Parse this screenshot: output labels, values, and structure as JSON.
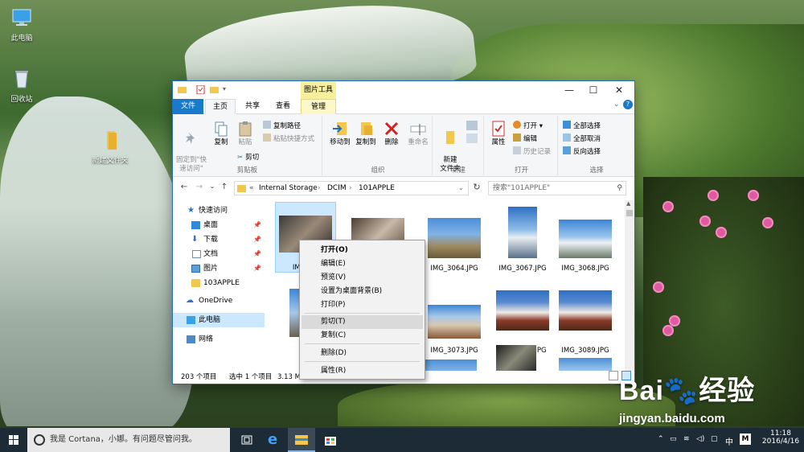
{
  "desktop": {
    "icons": [
      {
        "label": "此电脑"
      },
      {
        "label": "回收站"
      },
      {
        "label": "新建文件夹"
      }
    ]
  },
  "window": {
    "contextual_tab_group": "图片工具",
    "controls": {
      "minimize": "—",
      "maximize": "☐",
      "close": "✕",
      "help": "?"
    },
    "tabs": [
      "文件",
      "主页",
      "共享",
      "查看",
      "管理"
    ],
    "ribbon": {
      "clipboard": {
        "group": "剪贴板",
        "pin_quick": "固定到\"快\n速访问\"",
        "copy": "复制",
        "paste": "粘贴",
        "copy_path": "复制路径",
        "paste_shortcut": "粘贴快捷方式",
        "cut": "剪切"
      },
      "organize": {
        "group": "组织",
        "move_to": "移动到",
        "copy_to": "复制到"
      },
      "delete_group": {
        "delete": "删除",
        "rename": "重命名"
      },
      "new": {
        "group": "新建",
        "new_folder": "新建\n文件夹"
      },
      "open": {
        "group": "打开",
        "properties": "属性",
        "open": "打开",
        "edit": "编辑",
        "history": "历史记录"
      },
      "select": {
        "group": "选择",
        "select_all": "全部选择",
        "select_none": "全部取消",
        "invert": "反向选择"
      }
    },
    "address": {
      "prefix": "«",
      "crumbs": [
        "Internal Storage",
        "DCIM",
        "101APPLE"
      ],
      "search_placeholder": "搜索\"101APPLE\""
    },
    "nav": {
      "quick_access": "快速访问",
      "items": [
        {
          "label": "桌面",
          "pinned": "📌"
        },
        {
          "label": "下载",
          "pinned": "📌"
        },
        {
          "label": "文档",
          "pinned": "📌"
        },
        {
          "label": "图片",
          "pinned": "📌"
        },
        {
          "label": "103APPLE",
          "pinned": ""
        }
      ],
      "onedrive": "OneDrive",
      "this_pc": "此电脑",
      "network": "网络"
    },
    "files": [
      {
        "name": "IMG_3..."
      },
      {
        "name": ""
      },
      {
        "name": "IMG_3064.JPG"
      },
      {
        "name": "IMG_3067.JPG"
      },
      {
        "name": "IMG_3068.JPG"
      },
      {
        "name": ""
      },
      {
        "name": ""
      },
      {
        "name": "IMG_3073.JPG"
      },
      {
        "name": "IMG_3088.JPG"
      },
      {
        "name": "IMG_3089.JPG"
      }
    ],
    "status": {
      "count": "203 个项目",
      "selected": "选中 1 个项目",
      "size": "3.13 M"
    }
  },
  "context_menu": {
    "items": [
      {
        "label": "打开(O)",
        "bold": true
      },
      {
        "label": "编辑(E)"
      },
      {
        "label": "预览(V)"
      },
      {
        "label": "设置为桌面背景(B)"
      },
      {
        "label": "打印(P)"
      },
      {
        "label": "剪切(T)"
      },
      {
        "label": "复制(C)"
      },
      {
        "label": "删除(D)"
      },
      {
        "label": "属性(R)"
      }
    ]
  },
  "taskbar": {
    "cortana": "我是 Cortana，小娜。有问题尽管问我。",
    "ime": "中",
    "ime_mode": "M",
    "time": "11:18",
    "date": "2016/4/16"
  },
  "watermark": {
    "logo": "Bai🐾经验",
    "url": "jingyan.baidu.com"
  }
}
